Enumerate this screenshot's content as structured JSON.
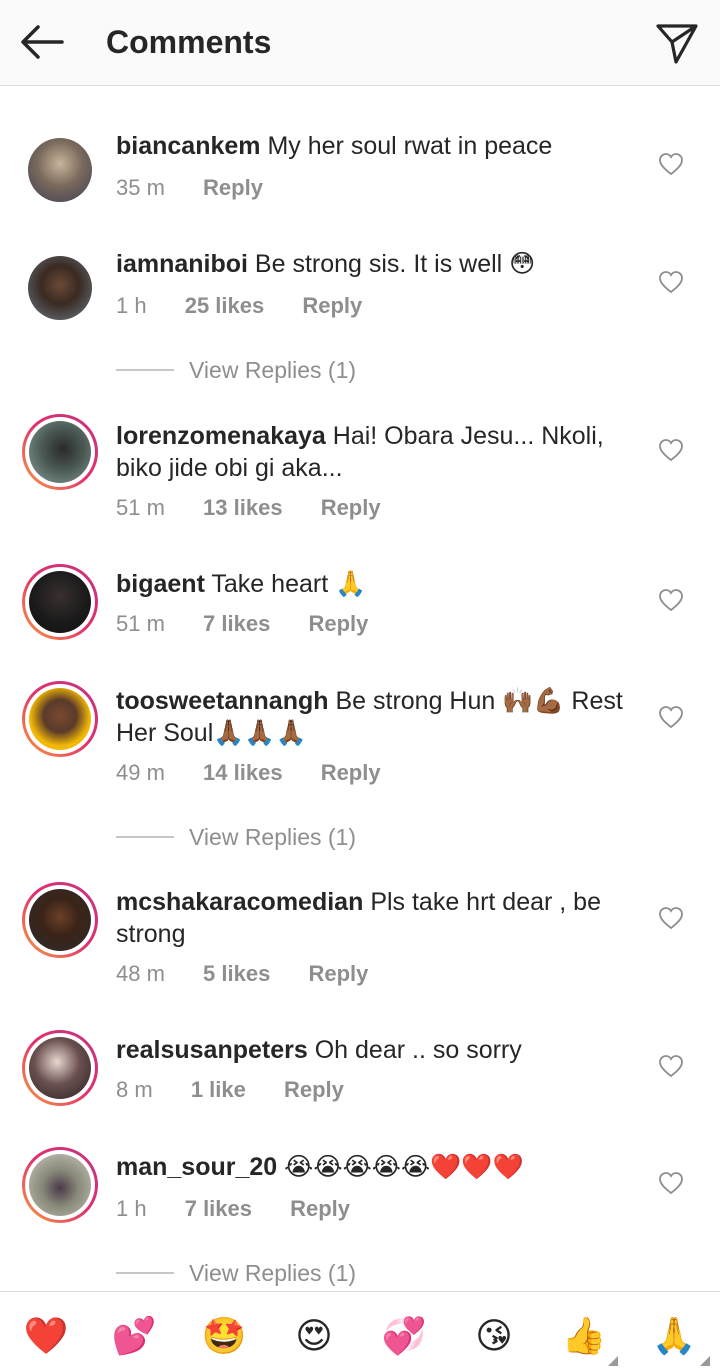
{
  "header": {
    "title": "Comments"
  },
  "comments": [
    {
      "user": "biancankem",
      "text": "My her soul rwat in peace",
      "time": "35 m",
      "likes": "",
      "reply": "Reply",
      "view_replies": ""
    },
    {
      "user": "iamnaniboi",
      "text": "Be strong sis. It is well 😳",
      "time": "1 h",
      "likes": "25 likes",
      "reply": "Reply",
      "view_replies": "View Replies (1)"
    },
    {
      "user": "lorenzomenakaya",
      "text": "Hai! Obara Jesu... Nkoli, biko jide obi gi aka...",
      "time": "51 m",
      "likes": "13 likes",
      "reply": "Reply",
      "view_replies": ""
    },
    {
      "user": "bigaent",
      "text": "Take heart 🙏",
      "time": "51 m",
      "likes": "7 likes",
      "reply": "Reply",
      "view_replies": ""
    },
    {
      "user": "toosweetannangh",
      "text": "Be strong Hun 🙌🏾💪🏾  Rest Her Soul🙏🏾🙏🏾🙏🏾",
      "time": "49 m",
      "likes": "14 likes",
      "reply": "Reply",
      "view_replies": "View Replies (1)"
    },
    {
      "user": "mcshakaracomedian",
      "text": "Pls take hrt dear , be strong",
      "time": "48 m",
      "likes": "5 likes",
      "reply": "Reply",
      "view_replies": ""
    },
    {
      "user": "realsusanpeters",
      "text": "Oh dear .. so sorry",
      "time": "8 m",
      "likes": "1 like",
      "reply": "Reply",
      "view_replies": ""
    },
    {
      "user": "man_sour_20",
      "text": "😭😭😭😭😭❤️❤️❤️",
      "time": "1 h",
      "likes": "7 likes",
      "reply": "Reply",
      "view_replies": "View Replies (1)"
    }
  ],
  "reactions": [
    "❤️",
    "💕",
    "🤩",
    "😍",
    "💞",
    "😘",
    "👍",
    "🙏"
  ],
  "colors": {
    "ring_start": "#f9a03f",
    "ring_end": "#c13584",
    "meta": "#8e8e8e",
    "text": "#262626"
  }
}
